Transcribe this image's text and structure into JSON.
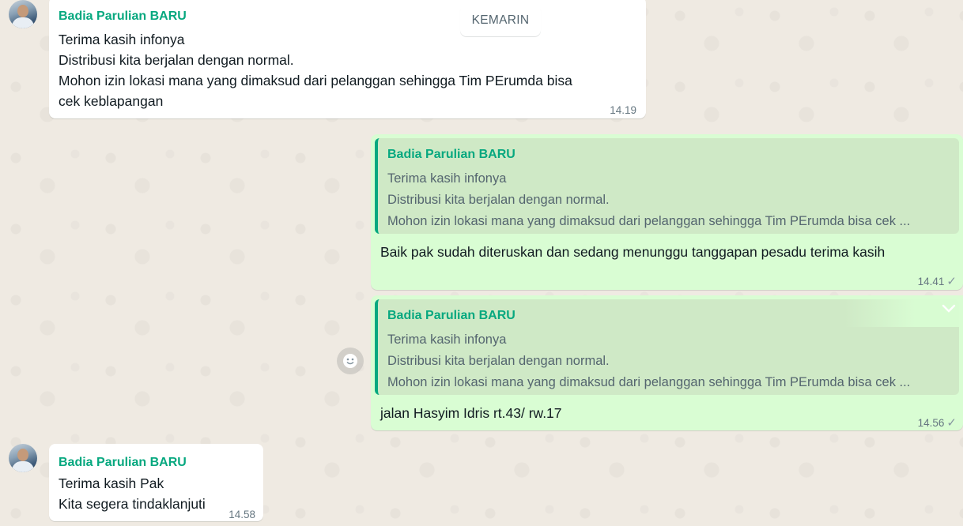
{
  "date_separator": "KEMARIN",
  "messages": [
    {
      "sender": "Badia Parulian BARU",
      "lines": [
        "Terima kasih infonya",
        "Distribusi kita berjalan dengan normal.",
        "Mohon izin lokasi mana yang dimaksud dari pelanggan sehingga Tim PErumda bisa",
        "cek keblapangan"
      ],
      "time": "14.19"
    },
    {
      "quote": {
        "sender": "Badia Parulian BARU",
        "lines": [
          "Terima kasih infonya",
          "Distribusi kita berjalan dengan normal.",
          "Mohon izin lokasi mana yang dimaksud dari pelanggan sehingga Tim PErumda bisa cek ..."
        ]
      },
      "text": "Baik pak sudah diteruskan dan sedang menunggu tanggapan pesadu terima kasih",
      "time": "14.41"
    },
    {
      "quote": {
        "sender": "Badia Parulian BARU",
        "lines": [
          "Terima kasih infonya",
          "Distribusi kita berjalan dengan normal.",
          "Mohon izin lokasi mana yang dimaksud dari pelanggan sehingga Tim PErumda bisa cek ..."
        ]
      },
      "text": "jalan Hasyim Idris rt.43/ rw.17",
      "time": "14.56"
    },
    {
      "sender": "Badia Parulian BARU",
      "lines": [
        "Terima kasih Pak",
        "Kita segera tindaklanjuti"
      ],
      "time": "14.58"
    }
  ],
  "icons": {
    "sent_check": "check-icon",
    "react": "emoji-icon",
    "menu": "chevron-down-icon"
  },
  "colors": {
    "sender_name": "#06a87f",
    "outgoing_bubble": "#d9fdd3",
    "incoming_bubble": "#ffffff",
    "chat_background": "#efeae2"
  }
}
